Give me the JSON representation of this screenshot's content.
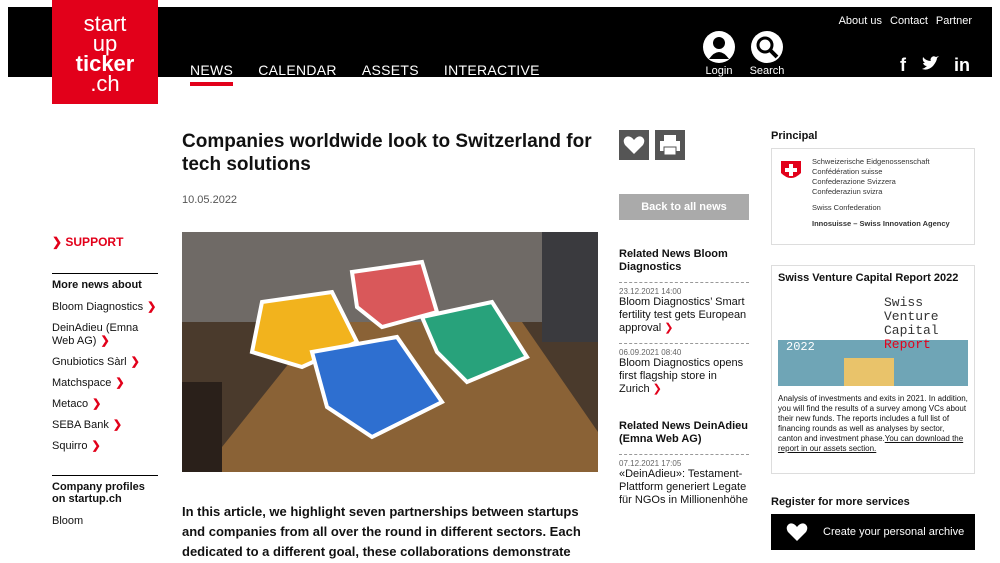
{
  "logo": {
    "line1": "start",
    "line2": "up",
    "line3": "ticker",
    "line4": ".ch"
  },
  "nav": [
    {
      "label": "NEWS"
    },
    {
      "label": "CALENDAR"
    },
    {
      "label": "ASSETS"
    },
    {
      "label": "INTERACTIVE"
    }
  ],
  "util": {
    "about": "About us",
    "contact": "Contact",
    "partner": "Partner",
    "login": "Login",
    "search": "Search"
  },
  "left": {
    "support": "SUPPORT",
    "more_title": "More news about",
    "links": [
      "Bloom Diagnostics",
      "DeinAdieu (Emna Web AG)",
      "Gnubiotics Sàrl",
      "Matchspace",
      "Metaco",
      "SEBA Bank",
      "Squirro"
    ],
    "profiles_title": "Company profiles on startup.ch",
    "profile_first": "Bloom"
  },
  "article": {
    "title": "Companies worldwide look to Switzerland for tech solutions",
    "date": "10.05.2022",
    "lead": "In this article, we highlight seven partnerships between startups and companies from all over the round in different sectors. Each dedicated to a different goal, these collaborations demonstrate"
  },
  "mid": {
    "back": "Back to all news",
    "rel1_title": "Related News Bloom Diagnostics",
    "rel1_items": [
      {
        "date": "23.12.2021 14:00",
        "text": "Bloom Diagnostics’ Smart fertility test gets European approval"
      },
      {
        "date": "06.09.2021 08:40",
        "text": "Bloom Diagnostics opens first flagship store in Zurich"
      }
    ],
    "rel2_title": "Related News DeinAdieu (Emna Web AG)",
    "rel2_items": [
      {
        "date": "07.12.2021 17:05",
        "text": "«DeinAdieu»: Testament-Plattform generiert Legate für NGOs in Millionenhöhe"
      }
    ]
  },
  "right": {
    "principal": "Principal",
    "conf": [
      "Schweizerische Eidgenossenschaft",
      "Confédération suisse",
      "Confederazione Svizzera",
      "Confederaziun svizra"
    ],
    "swissconf": "Swiss Confederation",
    "innosuisse": "Innosuisse – Swiss Innovation Agency",
    "report_title": "Swiss Venture Capital Report 2022",
    "report_img_lines": [
      "Swiss",
      "Venture",
      "Capital",
      "Report"
    ],
    "report_year": "2022",
    "report_text": "Analysis of investments and exits in 2021. In addition, you will find the results of a survey among VCs about their new funds. The reports includes a full list of financing rounds as well as analyses by sector, canton and investment phase.",
    "report_link": "You can download the report in our assets section.",
    "register": "Register for more services",
    "archive": "Create your personal archive"
  }
}
